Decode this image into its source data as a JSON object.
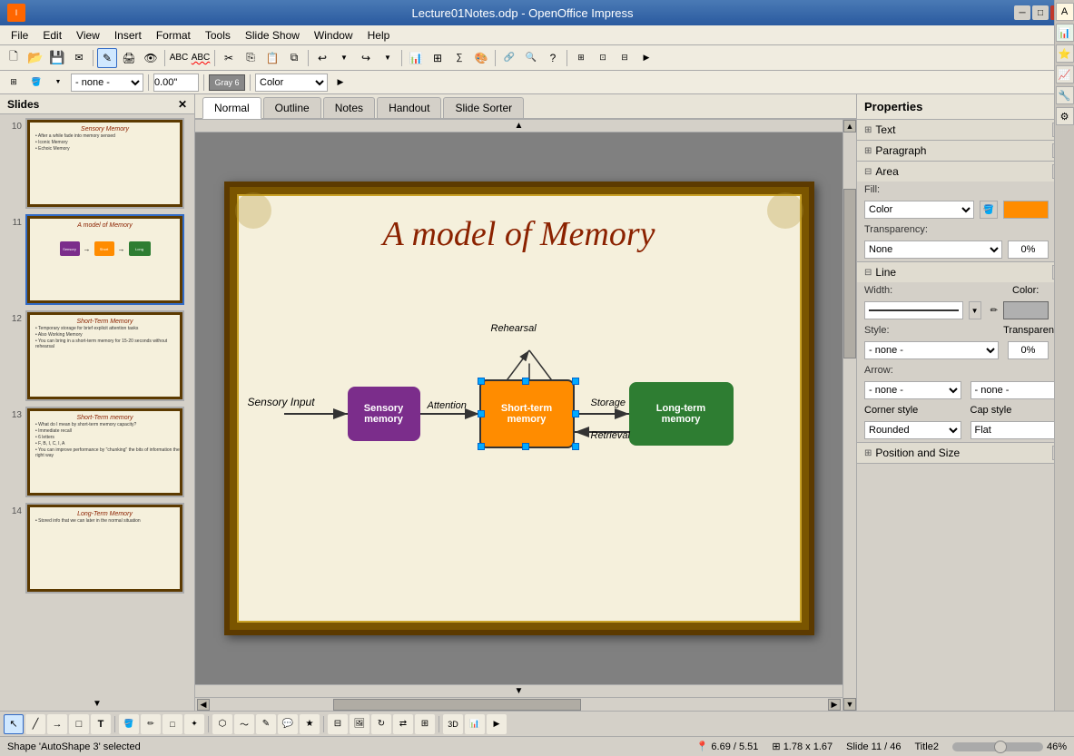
{
  "titlebar": {
    "title": "Lecture01Notes.odp - OpenOffice Impress",
    "icon": "I",
    "minimize": "─",
    "maximize": "□",
    "close": "✕"
  },
  "menubar": {
    "items": [
      "File",
      "Edit",
      "View",
      "Insert",
      "Format",
      "Tools",
      "Slide Show",
      "Window",
      "Help"
    ]
  },
  "tabs": {
    "items": [
      "Normal",
      "Outline",
      "Notes",
      "Handout",
      "Slide Sorter"
    ],
    "active": 0
  },
  "slides": {
    "label": "Slides",
    "items": [
      {
        "num": "10",
        "title": "Sensory Memory",
        "type": "text"
      },
      {
        "num": "11",
        "title": "A model of Memory",
        "type": "diagram",
        "selected": true
      },
      {
        "num": "12",
        "title": "Short-Term Memory",
        "type": "text"
      },
      {
        "num": "13",
        "title": "Short-Term memory",
        "type": "text"
      },
      {
        "num": "14",
        "title": "Long-Term Memory",
        "type": "text"
      }
    ]
  },
  "slide": {
    "title": "A model of Memory",
    "diagram": {
      "sensory_input_label": "Sensory Input",
      "sensory_memory_label": "Sensory\nmemory",
      "attention_label": "Attention",
      "short_term_label": "Short-term\nmemory",
      "rehearsal_label": "Rehearsal",
      "storage_label": "Storage",
      "retrieval_label": "Retrieval",
      "long_term_label": "Long-term\nmemory",
      "sensory_color": "#7b2d8b",
      "short_term_color": "#ff8c00",
      "long_term_color": "#2e7d32"
    }
  },
  "properties": {
    "title": "Properties",
    "sections": {
      "text": {
        "label": "Text",
        "expanded": true
      },
      "paragraph": {
        "label": "Paragraph",
        "expanded": true
      },
      "area": {
        "label": "Area",
        "expanded": true,
        "fill_label": "Fill:",
        "fill_type": "Color",
        "fill_color": "#ff8c00",
        "transparency_label": "Transparency:",
        "transparency_type": "None",
        "transparency_value": "0%"
      },
      "line": {
        "label": "Line",
        "expanded": true,
        "width_label": "Width:",
        "color_label": "Color:",
        "style_label": "Style:",
        "style_value": "- none -",
        "transparency_label": "Transparency:",
        "transparency_value": "0%",
        "arrow_label": "Arrow:",
        "arrow_start": "- none -",
        "arrow_end": "- none -",
        "corner_style_label": "Corner style",
        "corner_style_value": "Rounded",
        "cap_style_label": "Cap style",
        "cap_style_value": "Flat"
      },
      "position_and_size": {
        "label": "Position and Size",
        "expanded": true
      }
    }
  },
  "statusbar": {
    "shape_info": "Shape 'AutoShape 3' selected",
    "position": "6.69 / 5.51",
    "size": "1.78 x 1.67",
    "slide_info": "Slide 11 / 46",
    "layout": "Title2",
    "zoom": "46%"
  },
  "toolbar2": {
    "none_select": "- none -",
    "rotation": "0.00\"",
    "color_label": "Gray 6",
    "color_mode": "Color"
  }
}
